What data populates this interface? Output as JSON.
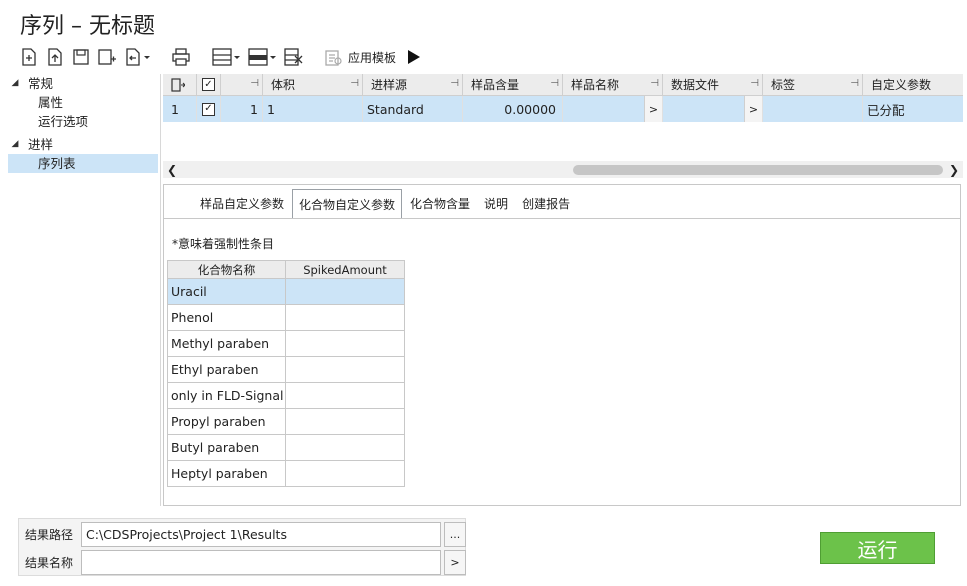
{
  "window": {
    "title": "序列 – 无标题"
  },
  "toolbar": {
    "apply_template_label": "应用模板"
  },
  "sidebar": {
    "groups": [
      {
        "label": "常规",
        "items": [
          "属性",
          "运行选项"
        ]
      },
      {
        "label": "进样",
        "items": [
          "序列表"
        ]
      }
    ]
  },
  "grid": {
    "headers": [
      "体积",
      "进样源",
      "样品含量",
      "样品名称",
      "数据文件",
      "标签",
      "自定义参数"
    ],
    "row": {
      "index": "1",
      "checked": "✓",
      "line": "1",
      "volume": "1",
      "source": "Standard",
      "amount": "0.00000",
      "name": "",
      "datafile": "",
      "label": "",
      "custom": "已分配",
      "expand_glyph": ">"
    }
  },
  "tabs": [
    "样品自定义参数",
    "化合物自定义参数",
    "化合物含量",
    "说明",
    "创建报告"
  ],
  "panel": {
    "note": "*意味着强制性条目",
    "columns": [
      "化合物名称",
      "SpikedAmount"
    ],
    "compounds": [
      "Uracil",
      "Phenol",
      "Methyl paraben",
      "Ethyl paraben",
      "only in FLD-Signal",
      "Propyl paraben",
      "Butyl paraben",
      "Heptyl paraben"
    ]
  },
  "bottom": {
    "result_path_label": "结果路径",
    "result_path_value": "C:\\CDSProjects\\Project 1\\Results",
    "result_name_label": "结果名称",
    "result_name_value": "",
    "browse_glyph": "...",
    "arrow_glyph": ">"
  },
  "run_button": {
    "label": "运行",
    "color": "#6cc24a"
  }
}
